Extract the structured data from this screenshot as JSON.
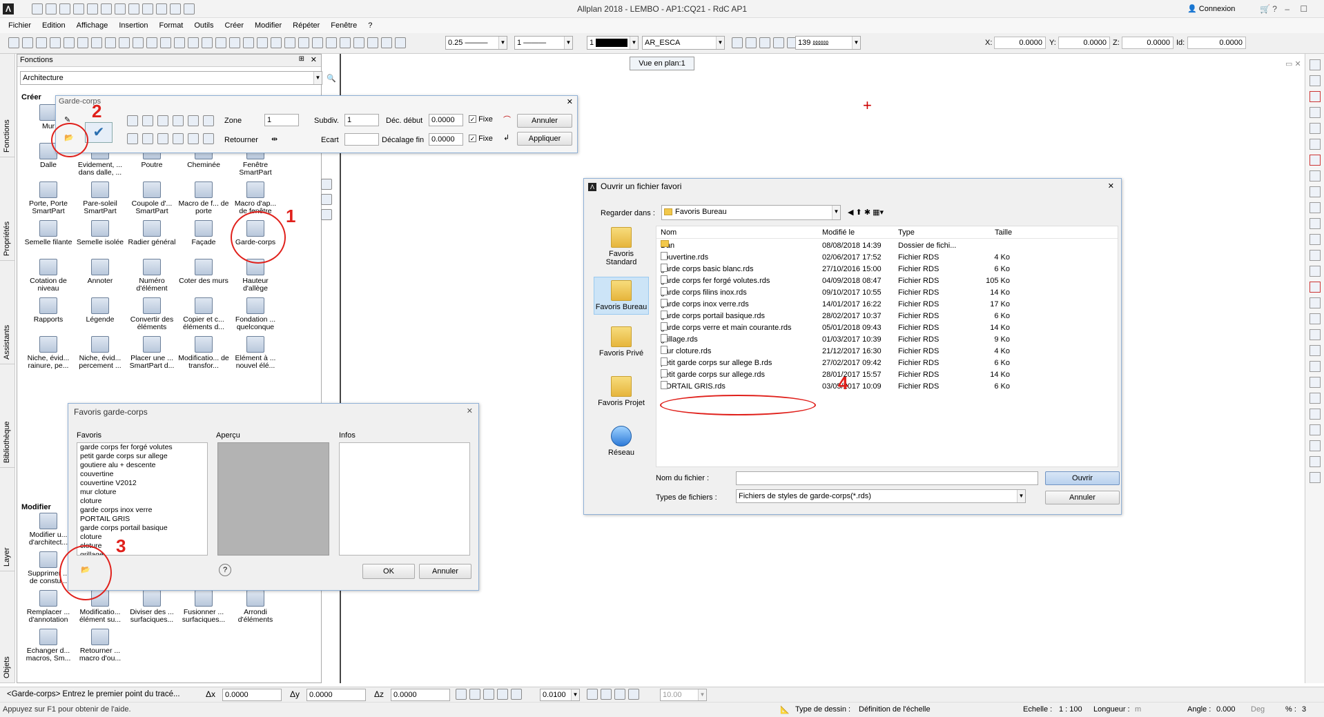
{
  "app": {
    "title": "Allplan 2018 - LEMBO - AP1:CQ21 - RdC AP1",
    "connexion": "Connexion"
  },
  "menu": [
    "Fichier",
    "Edition",
    "Affichage",
    "Insertion",
    "Format",
    "Outils",
    "Créer",
    "Modifier",
    "Répéter",
    "Fenêtre",
    "?"
  ],
  "toolbar": {
    "pen": "0.25",
    "line": "1",
    "color": "1",
    "layer": "AR_ESCA",
    "scale_val": "139",
    "x_label": "X:",
    "x_val": "0.0000",
    "y_label": "Y:",
    "y_val": "0.0000",
    "z_label": "Z:",
    "z_val": "0.0000",
    "id_label": "Id:",
    "id_val": "0.0000"
  },
  "viewtooltip": "Vue en plan:1",
  "vtabs": [
    "Fonctions",
    "Propriétés",
    "Assistants",
    "Bibliothèque",
    "Layer",
    "Objets"
  ],
  "fonctions": {
    "title": "Fonctions",
    "category": "Architecture",
    "creer": "Créer",
    "modifier": "Modifier",
    "grid": [
      [
        "Mur",
        "",
        "",
        "",
        ""
      ],
      [
        "Dalle",
        "Evidement, ... dans dalle, ...",
        "Poutre",
        "Cheminée",
        "Fenêtre SmartPart"
      ],
      [
        "Porte, Porte SmartPart",
        "Pare-soleil SmartPart",
        "Coupole d'... SmartPart",
        "Macro de f... de porte",
        "Macro d'ap... de fenêtre"
      ],
      [
        "Semelle filante",
        "Semelle isolée",
        "Radier général",
        "Façade",
        "Garde-corps"
      ],
      [
        "Cotation de niveau",
        "Annoter",
        "Numéro d'élément",
        "Coter des murs",
        "Hauteur d'allège"
      ],
      [
        "Rapports",
        "Légende",
        "Convertir des éléments",
        "Copier et c... éléments d...",
        "Fondation ... quelconque"
      ],
      [
        "Niche, évid... rainure, pe...",
        "Niche, évid... percement ...",
        "Placer une ... SmartPart d...",
        "Modificatio... de transfor...",
        "Elément à ... nouvel élé..."
      ]
    ],
    "modgrid": [
      [
        "Modifier u... d'architect...",
        "",
        "",
        "",
        ""
      ],
      [
        "Supprimer ... de constu...",
        "",
        "",
        "",
        ""
      ],
      [
        "Remplacer ... d'annotation",
        "Modificatio... élément su...",
        "Diviser des ... surfaciques...",
        "Fusionner ... surfaciques...",
        "Arrondi d'éléments"
      ],
      [
        "Echanger d... macros, Sm...",
        "Retourner ... macro d'ou...",
        "",
        "",
        ""
      ]
    ]
  },
  "gardecorps": {
    "title": "Garde-corps",
    "zone_label": "Zone",
    "zone_val": "1",
    "retourner_label": "Retourner",
    "subdiv_label": "Subdiv.",
    "subdiv_val": "1",
    "ecart_label": "Ecart",
    "ecart_val": "",
    "dec_debut_label": "Déc. début",
    "dec_debut_val": "0.0000",
    "dec_fin_label": "Décalage fin",
    "dec_fin_val": "0.0000",
    "fixe_label": "Fixe",
    "annuler": "Annuler",
    "appliquer": "Appliquer"
  },
  "favoris": {
    "title": "Favoris garde-corps",
    "col_favoris": "Favoris",
    "col_apercu": "Aperçu",
    "col_infos": "Infos",
    "items": [
      "garde corps fer forgé volutes",
      "petit garde corps sur allege",
      "goutiere alu + descente",
      "couvertine",
      "couvertine V2012",
      "mur cloture",
      "cloture",
      "garde corps inox verre",
      "PORTAIL GRIS",
      "garde corps portail basique",
      "cloture",
      "cloture",
      "grillage"
    ],
    "help": "?",
    "ok": "OK",
    "annuler": "Annuler"
  },
  "open": {
    "title": "Ouvrir un fichier favori",
    "lookin_label": "Regarder dans :",
    "lookin_val": "Favoris Bureau",
    "places": [
      "Favoris Standard",
      "Favoris Bureau",
      "Favoris Privé",
      "Favoris Projet",
      "Réseau"
    ],
    "headers": [
      "Nom",
      "Modifié le",
      "Type",
      "Taille"
    ],
    "files": [
      {
        "name": "Dan",
        "date": "08/08/2018 14:39",
        "type": "Dossier de fichi...",
        "size": "",
        "folder": true
      },
      {
        "name": "couvertine.rds",
        "date": "02/06/2017 17:52",
        "type": "Fichier RDS",
        "size": "4 Ko"
      },
      {
        "name": "garde corps basic blanc.rds",
        "date": "27/10/2016 15:00",
        "type": "Fichier RDS",
        "size": "6 Ko"
      },
      {
        "name": "garde corps fer forgé volutes.rds",
        "date": "04/09/2018 08:47",
        "type": "Fichier RDS",
        "size": "105 Ko"
      },
      {
        "name": "garde corps filins inox.rds",
        "date": "09/10/2017 10:55",
        "type": "Fichier RDS",
        "size": "14 Ko"
      },
      {
        "name": "garde corps inox verre.rds",
        "date": "14/01/2017 16:22",
        "type": "Fichier RDS",
        "size": "17 Ko"
      },
      {
        "name": "garde corps portail basique.rds",
        "date": "28/02/2017 10:37",
        "type": "Fichier RDS",
        "size": "6 Ko"
      },
      {
        "name": "garde corps verre et main courante.rds",
        "date": "05/01/2018 09:43",
        "type": "Fichier RDS",
        "size": "14 Ko"
      },
      {
        "name": "grillage.rds",
        "date": "01/03/2017 10:39",
        "type": "Fichier RDS",
        "size": "9 Ko"
      },
      {
        "name": "mur cloture.rds",
        "date": "21/12/2017 16:30",
        "type": "Fichier RDS",
        "size": "4 Ko"
      },
      {
        "name": "petit garde corps sur allege B.rds",
        "date": "27/02/2017 09:42",
        "type": "Fichier RDS",
        "size": "6 Ko"
      },
      {
        "name": "petit garde corps sur allege.rds",
        "date": "28/01/2017 15:57",
        "type": "Fichier RDS",
        "size": "14 Ko"
      },
      {
        "name": "PORTAIL GRIS.rds",
        "date": "03/05/2017 10:09",
        "type": "Fichier RDS",
        "size": "6 Ko"
      }
    ],
    "filename_label": "Nom du fichier :",
    "filename_val": "",
    "types_label": "Types de fichiers :",
    "types_val": "Fichiers de styles de garde-corps(*.rds)",
    "ouvrir": "Ouvrir",
    "annuler": "Annuler"
  },
  "annotations": [
    "1",
    "2",
    "3",
    "4"
  ],
  "statusbar": {
    "prompt": "<Garde-corps> Entrez le premier point du tracé...",
    "dx_label": "Δx",
    "dx_val": "0.0000",
    "dy_label": "Δy",
    "dy_val": "0.0000",
    "dz_label": "Δz",
    "dz_val": "0.0000",
    "step_val": "0.0100",
    "snap_val": "10.00",
    "help": "Appuyez sur F1 pour obtenir de l'aide.",
    "type_dessin_label": "Type de dessin :",
    "type_dessin_val": "Définition de l'échelle",
    "echelle_label": "Echelle :",
    "echelle_val": "1 : 100",
    "longueur_label": "Longueur :",
    "longueur_val": "m",
    "angle_label": "Angle :",
    "angle_val": "0.000",
    "deg": "Deg",
    "percent_label": "% :",
    "percent_val": "3"
  },
  "colors": {
    "accent": "#e0201b",
    "selection": "#cce4f7",
    "dialog_border": "#8fb0d6"
  }
}
